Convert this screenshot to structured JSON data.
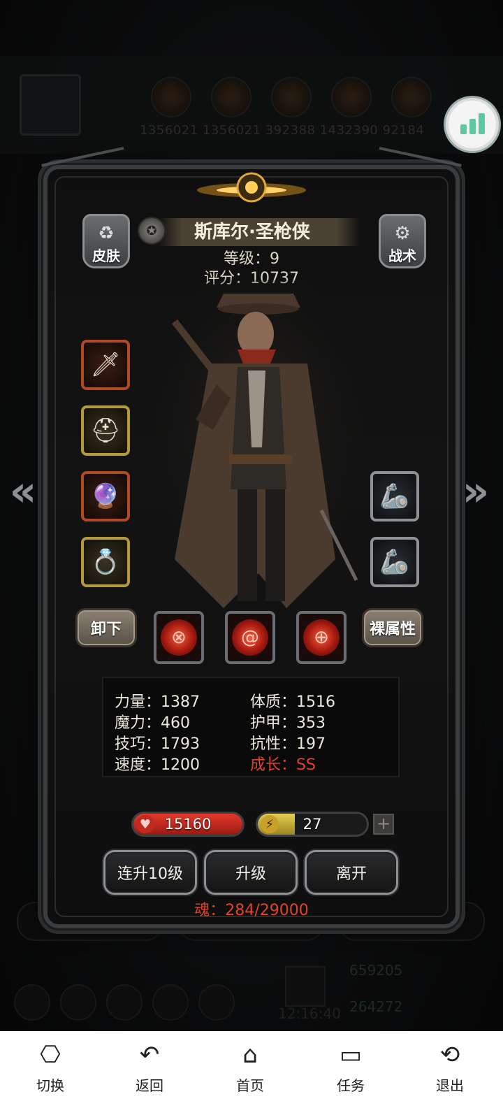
{
  "background": {
    "numbers": "1356021  1356021  392388  1432390  92184",
    "time": "12:16:40",
    "stat1": "659205",
    "stat2": "264272"
  },
  "character": {
    "name": "斯库尔·圣枪侠",
    "level_text": "等级：9",
    "score_text": "评分：10737"
  },
  "buttons": {
    "skin": "皮肤",
    "tactics": "战术",
    "unequip": "卸下",
    "naked_attr": "裸属性",
    "level_up_10": "连升10级",
    "level_up": "升级",
    "leave": "离开"
  },
  "stats": {
    "strength": "力量：1387",
    "constitution": "体质：1516",
    "magic": "魔力：460",
    "armor": "护甲：353",
    "skill": "技巧：1793",
    "resistance": "抗性：197",
    "speed": "速度：1200",
    "growth": "成长：SS"
  },
  "bars": {
    "hp": "15160",
    "energy": "27",
    "energy_fill_fraction": 0.34
  },
  "soul_text": "魂：284/29000",
  "icons": {
    "skin": "shirt-refresh-icon",
    "tactics": "gear-icon",
    "hp": "heart-icon",
    "energy": "lightning-icon"
  },
  "colors": {
    "growth": "#e0432a",
    "soul": "#e0432a",
    "hp_bar": "#c2241c",
    "energy_bar": "#c9b43a"
  },
  "system_nav": {
    "switch": "切换",
    "back": "返回",
    "home": "首页",
    "tasks": "任务",
    "exit": "退出"
  }
}
